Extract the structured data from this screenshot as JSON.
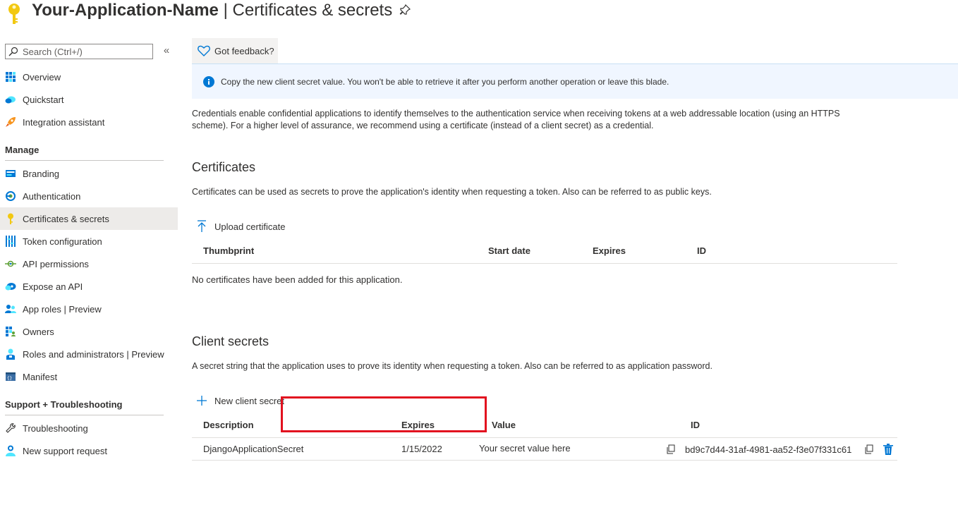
{
  "header": {
    "app_name": "Your-Application-Name",
    "separator": " | ",
    "page_name": "Certificates & secrets",
    "accent_color": "#f2c811"
  },
  "sidebar": {
    "search": {
      "placeholder": "Search (Ctrl+/)"
    },
    "collapse_symbol": "«",
    "top_items": [
      {
        "label": "Overview",
        "icon": "grid-icon"
      },
      {
        "label": "Quickstart",
        "icon": "cloud-icon"
      },
      {
        "label": "Integration assistant",
        "icon": "rocket-icon"
      }
    ],
    "manage_label": "Manage",
    "manage_items": [
      {
        "label": "Branding",
        "icon": "branding-icon"
      },
      {
        "label": "Authentication",
        "icon": "authentication-icon"
      },
      {
        "label": "Certificates & secrets",
        "icon": "key-icon",
        "active": true
      },
      {
        "label": "Token configuration",
        "icon": "token-bars-icon"
      },
      {
        "label": "API permissions",
        "icon": "api-permissions-icon"
      },
      {
        "label": "Expose an API",
        "icon": "cloud-api-icon"
      },
      {
        "label": "App roles | Preview",
        "icon": "app-roles-icon"
      },
      {
        "label": "Owners",
        "icon": "owners-icon"
      },
      {
        "label": "Roles and administrators | Preview",
        "icon": "admin-icon"
      },
      {
        "label": "Manifest",
        "icon": "manifest-icon"
      }
    ],
    "support_label": "Support + Troubleshooting",
    "support_items": [
      {
        "label": "Troubleshooting",
        "icon": "wrench-icon"
      },
      {
        "label": "New support request",
        "icon": "support-person-icon"
      }
    ]
  },
  "main": {
    "feedback_label": "Got feedback?",
    "info_message": "Copy the new client secret value. You won't be able to retrieve it after you perform another operation or leave this blade.",
    "description": "Credentials enable confidential applications to identify themselves to the authentication service when receiving tokens at a web addressable location (using an HTTPS scheme). For a higher level of assurance, we recommend using a certificate (instead of a client secret) as a credential.",
    "certificates": {
      "heading": "Certificates",
      "description": "Certificates can be used as secrets to prove the application's identity when requesting a token. Also can be referred to as public keys.",
      "upload_label": "Upload certificate",
      "columns": [
        "Thumbprint",
        "Start date",
        "Expires",
        "ID"
      ],
      "empty_message": "No certificates have been added for this application."
    },
    "client_secrets": {
      "heading": "Client secrets",
      "description": "A secret string that the application uses to prove its identity when requesting a token. Also can be referred to as application password.",
      "new_label": "New client secret",
      "columns": [
        "Description",
        "Expires",
        "Value",
        "ID"
      ],
      "rows": [
        {
          "description": "DjangoApplicationSecret",
          "expires": "1/15/2022",
          "value": "Your secret value here",
          "id": "bd9c7d44-31af-4981-aa52-f3e07f331c61"
        }
      ]
    },
    "highlight_color": "#e2111f"
  }
}
